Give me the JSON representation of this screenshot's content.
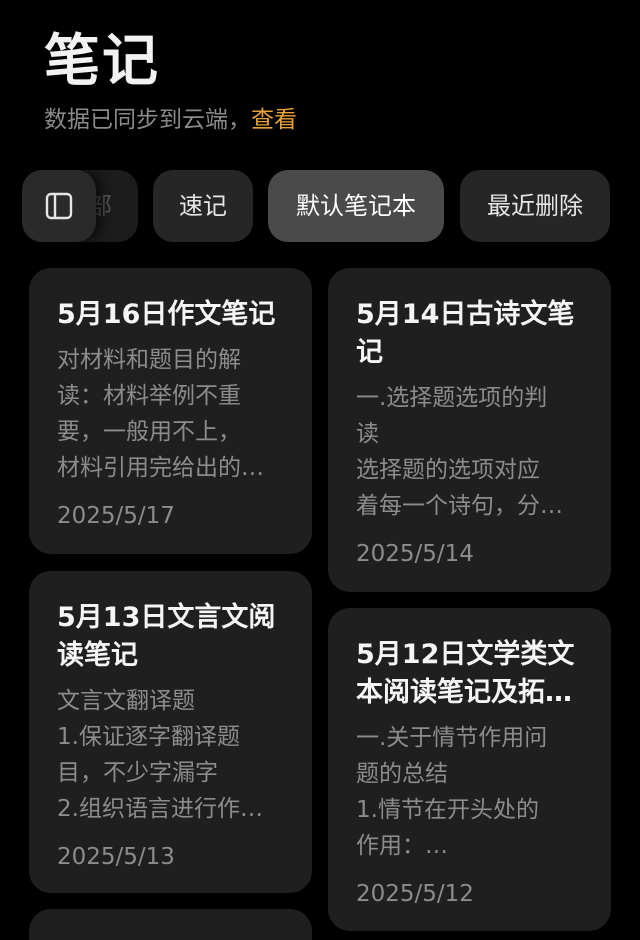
{
  "header": {
    "title": "笔记",
    "sync_text": "数据已同步到云端，",
    "sync_link": "查看"
  },
  "filters": {
    "hidden_chip_label": "全部",
    "items": [
      {
        "label": "速记",
        "active": false
      },
      {
        "label": "默认笔记本",
        "active": true
      },
      {
        "label": "最近删除",
        "active": false
      }
    ]
  },
  "notes": [
    {
      "title": "5月16日作文笔记",
      "preview": "对材料和题目的解\n读：材料举例不重\n要，一般用不上，\n材料引用完给出的…",
      "date": "2025/5/17"
    },
    {
      "title": "5月14日古诗文笔\n记",
      "preview": "一.选择题选项的判\n读\n选择题的选项对应\n着每一个诗句，分…",
      "date": "2025/5/14"
    },
    {
      "title": "5月13日文言文阅\n读笔记",
      "preview": "文言文翻译题\n1.保证逐字翻译题\n目，不少字漏字\n2.组织语言进行作…",
      "date": "2025/5/13"
    },
    {
      "title": "5月12日文学类文\n本阅读笔记及拓…",
      "preview": "一.关于情节作用问\n题的总结\n1.情节在开头处的\n作用：…",
      "date": "2025/5/12"
    }
  ],
  "colors": {
    "background": "#000000",
    "card": "#1f1f1f",
    "accent": "#e8a13a",
    "chip_active": "#4a4a4a"
  },
  "icons": {
    "sidebar_toggle": "sidebar-panel-icon"
  }
}
